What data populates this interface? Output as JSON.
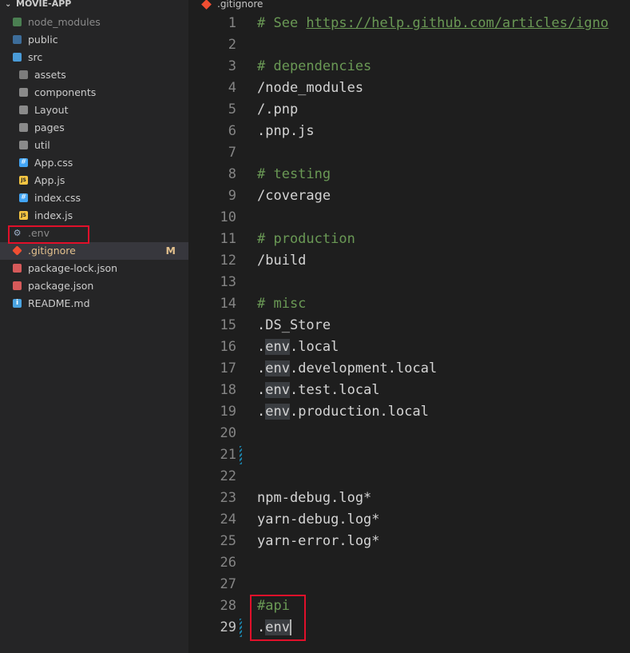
{
  "explorer": {
    "project": "MOVIE-APP",
    "items": [
      {
        "label": "node_modules",
        "icon": "folder-node-icon",
        "depth": 0,
        "dim": true
      },
      {
        "label": "public",
        "icon": "folder-public-icon",
        "depth": 0
      },
      {
        "label": "src",
        "icon": "folder-src-open-icon",
        "depth": 0
      },
      {
        "label": "assets",
        "icon": "folder-assets-icon",
        "depth": 1
      },
      {
        "label": "components",
        "icon": "folder-icon",
        "depth": 1
      },
      {
        "label": "Layout",
        "icon": "folder-icon",
        "depth": 1
      },
      {
        "label": "pages",
        "icon": "folder-icon",
        "depth": 1
      },
      {
        "label": "util",
        "icon": "folder-icon",
        "depth": 1
      },
      {
        "label": "App.css",
        "icon": "css-file-icon",
        "depth": 1
      },
      {
        "label": "App.js",
        "icon": "js-file-icon",
        "depth": 1
      },
      {
        "label": "index.css",
        "icon": "css-file-icon",
        "depth": 1
      },
      {
        "label": "index.js",
        "icon": "js-file-icon",
        "depth": 1
      },
      {
        "label": ".env",
        "icon": "env-file-icon",
        "depth": 0,
        "dim": true
      },
      {
        "label": ".gitignore",
        "icon": "git-file-icon",
        "depth": 0,
        "selected": true,
        "badge": "M"
      },
      {
        "label": "package-lock.json",
        "icon": "json-lock-file-icon",
        "depth": 0
      },
      {
        "label": "package.json",
        "icon": "json-file-icon",
        "depth": 0
      },
      {
        "label": "README.md",
        "icon": "info-file-icon",
        "depth": 0
      }
    ]
  },
  "tab": {
    "label": ".gitignore"
  },
  "code_lines": [
    "# See https://help.github.com/articles/igno",
    "",
    "# dependencies",
    "/node_modules",
    "/.pnp",
    ".pnp.js",
    "",
    "# testing",
    "/coverage",
    "",
    "# production",
    "/build",
    "",
    "# misc",
    ".DS_Store",
    ".env.local",
    ".env.development.local",
    ".env.test.local",
    ".env.production.local",
    "",
    "",
    "",
    "npm-debug.log*",
    "yarn-debug.log*",
    "yarn-error.log*",
    "",
    "",
    "#api",
    ".env"
  ],
  "active_line": 29,
  "colors": {
    "comment": "#6a9955",
    "git_modified": "#e2c08d",
    "annotation_box": "#e0102a"
  }
}
